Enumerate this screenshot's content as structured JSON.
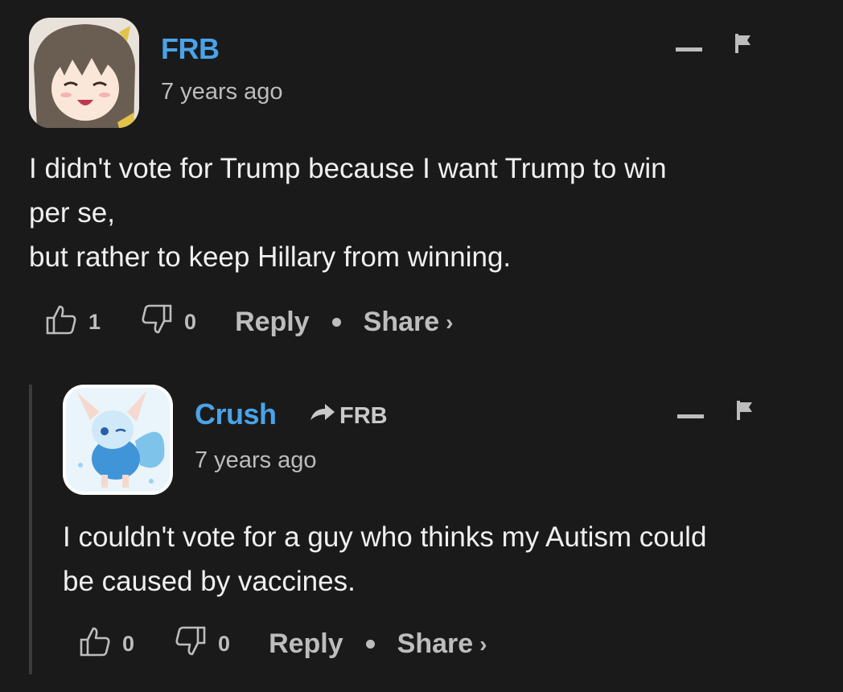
{
  "comments": [
    {
      "author": "FRB",
      "timestamp": "7 years ago",
      "text": "I didn't vote for Trump because I want Trump to win\nper se,\nbut rather to keep Hillary from winning.",
      "upvotes": "1",
      "downvotes": "0",
      "reply_label": "Reply",
      "share_label": "Share",
      "share_chevron": "›",
      "minimize_icon": "minus-icon",
      "flag_icon": "flag-icon"
    },
    {
      "author": "Crush",
      "reply_to": "FRB",
      "timestamp": "7 years ago",
      "text": "I couldn't vote for a guy who thinks my Autism could\nbe caused by vaccines.",
      "upvotes": "0",
      "downvotes": "0",
      "reply_label": "Reply",
      "share_label": "Share",
      "share_chevron": "›",
      "minimize_icon": "minus-icon",
      "flag_icon": "flag-icon"
    }
  ],
  "colors": {
    "background": "#1a1a1b",
    "author": "#4aa3e8",
    "text": "#f0f0f0",
    "muted": "#bdbdbd",
    "thread_line": "#3b3b3b"
  }
}
